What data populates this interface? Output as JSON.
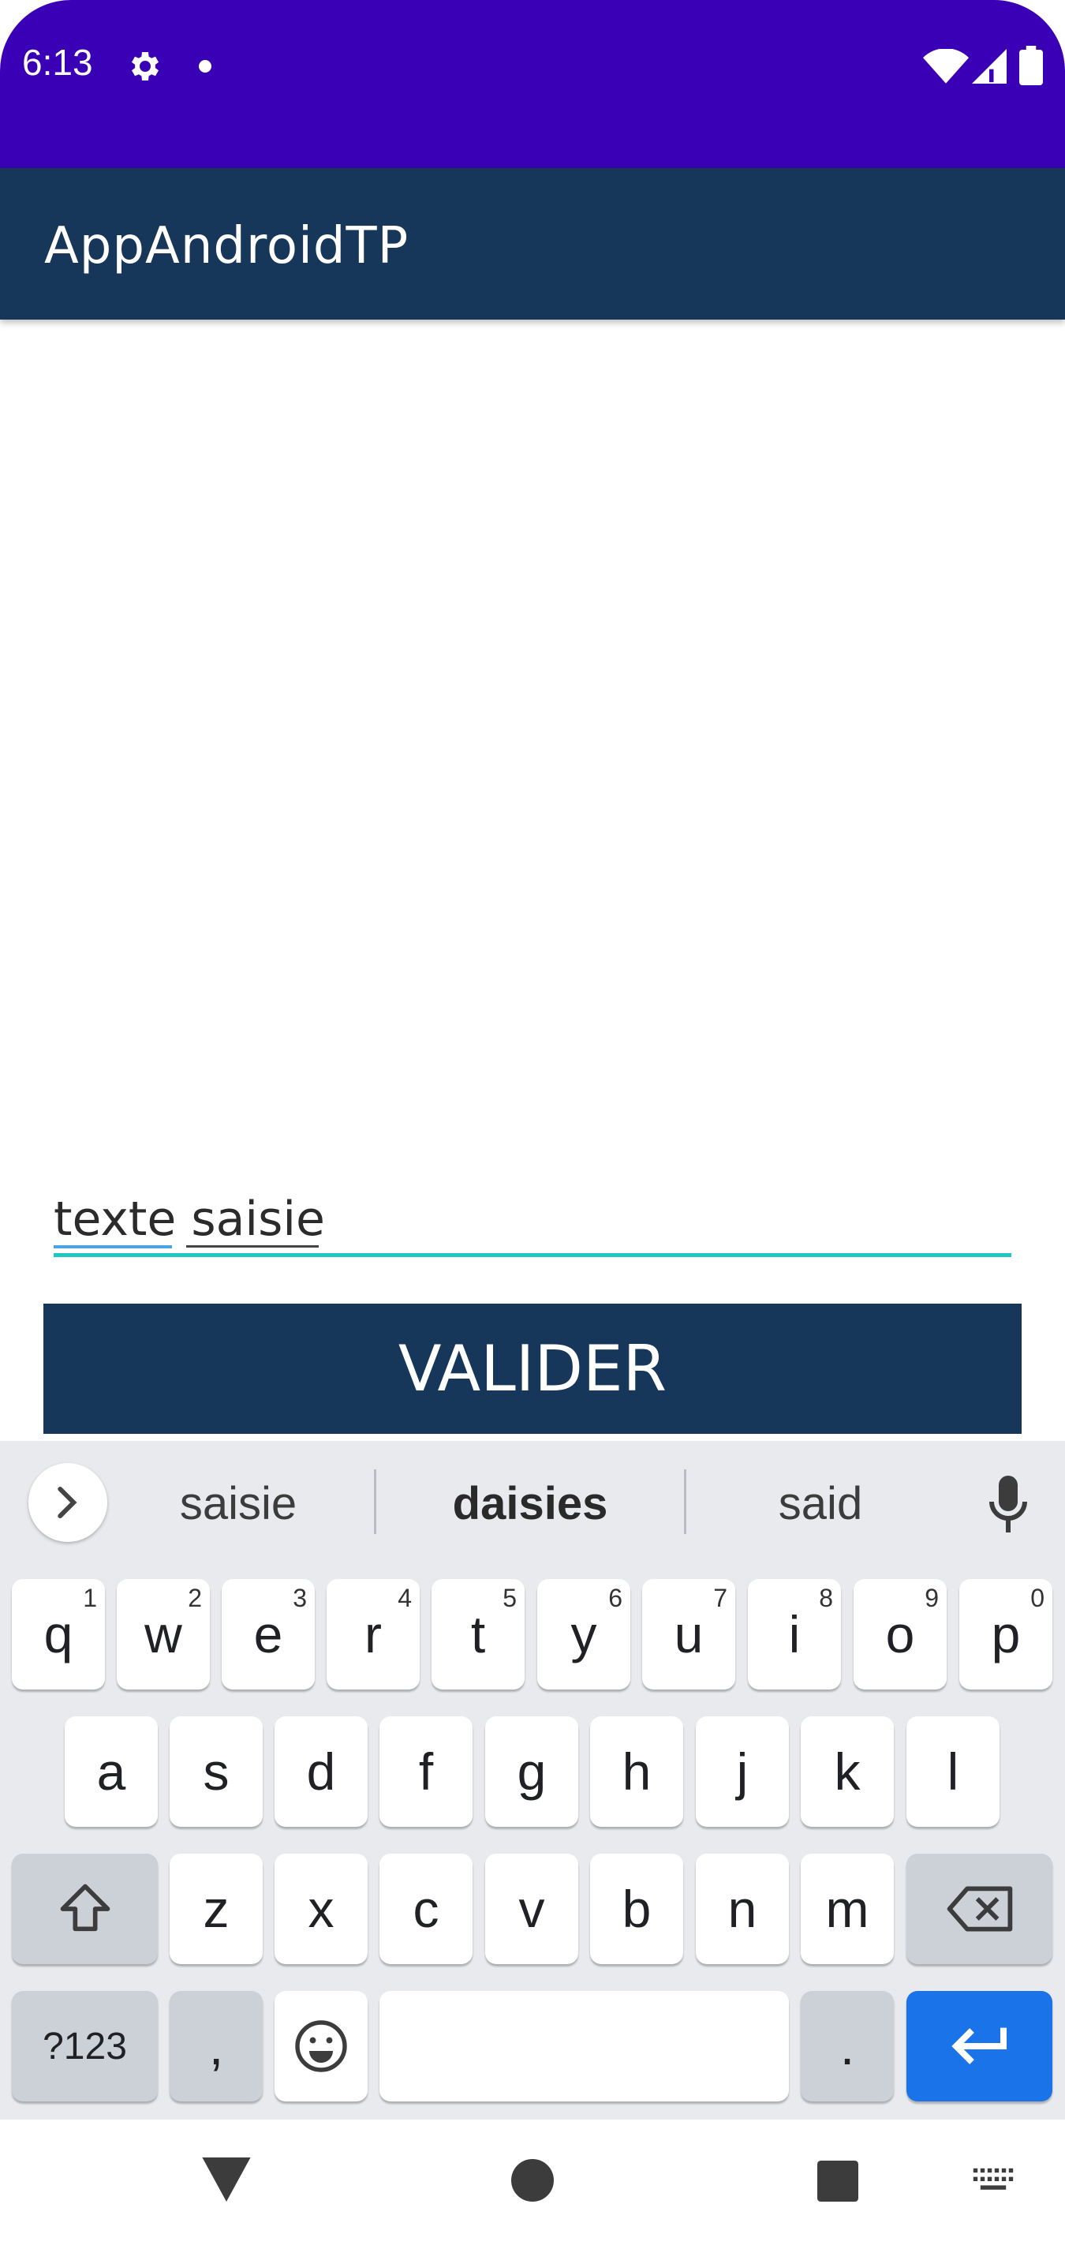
{
  "status_bar": {
    "time": "6:13",
    "background": "#3a00b5"
  },
  "app_bar": {
    "title": "AppAndroidTP",
    "background": "#16375a"
  },
  "input": {
    "value": "texte saisie",
    "underline_color": "#1ec7c3"
  },
  "button": {
    "label": "VALIDER"
  },
  "keyboard": {
    "suggestions": [
      "saisie",
      "daisies",
      "said"
    ],
    "row1": [
      {
        "key": "q",
        "hint": "1"
      },
      {
        "key": "w",
        "hint": "2"
      },
      {
        "key": "e",
        "hint": "3"
      },
      {
        "key": "r",
        "hint": "4"
      },
      {
        "key": "t",
        "hint": "5"
      },
      {
        "key": "y",
        "hint": "6"
      },
      {
        "key": "u",
        "hint": "7"
      },
      {
        "key": "i",
        "hint": "8"
      },
      {
        "key": "o",
        "hint": "9"
      },
      {
        "key": "p",
        "hint": "0"
      }
    ],
    "row2": [
      "a",
      "s",
      "d",
      "f",
      "g",
      "h",
      "j",
      "k",
      "l"
    ],
    "row3": [
      "z",
      "x",
      "c",
      "v",
      "b",
      "n",
      "m"
    ],
    "symbols_label": "?123",
    "comma_label": ",",
    "period_label": ".",
    "enter_color": "#1a73e8"
  },
  "icons": [
    "settings-icon",
    "wifi-icon",
    "signal-icon",
    "battery-icon",
    "chevron-right-icon",
    "mic-icon",
    "shift-icon",
    "backspace-icon",
    "emoji-icon",
    "enter-icon",
    "back-icon",
    "home-icon",
    "recents-icon",
    "keyboard-icon"
  ]
}
